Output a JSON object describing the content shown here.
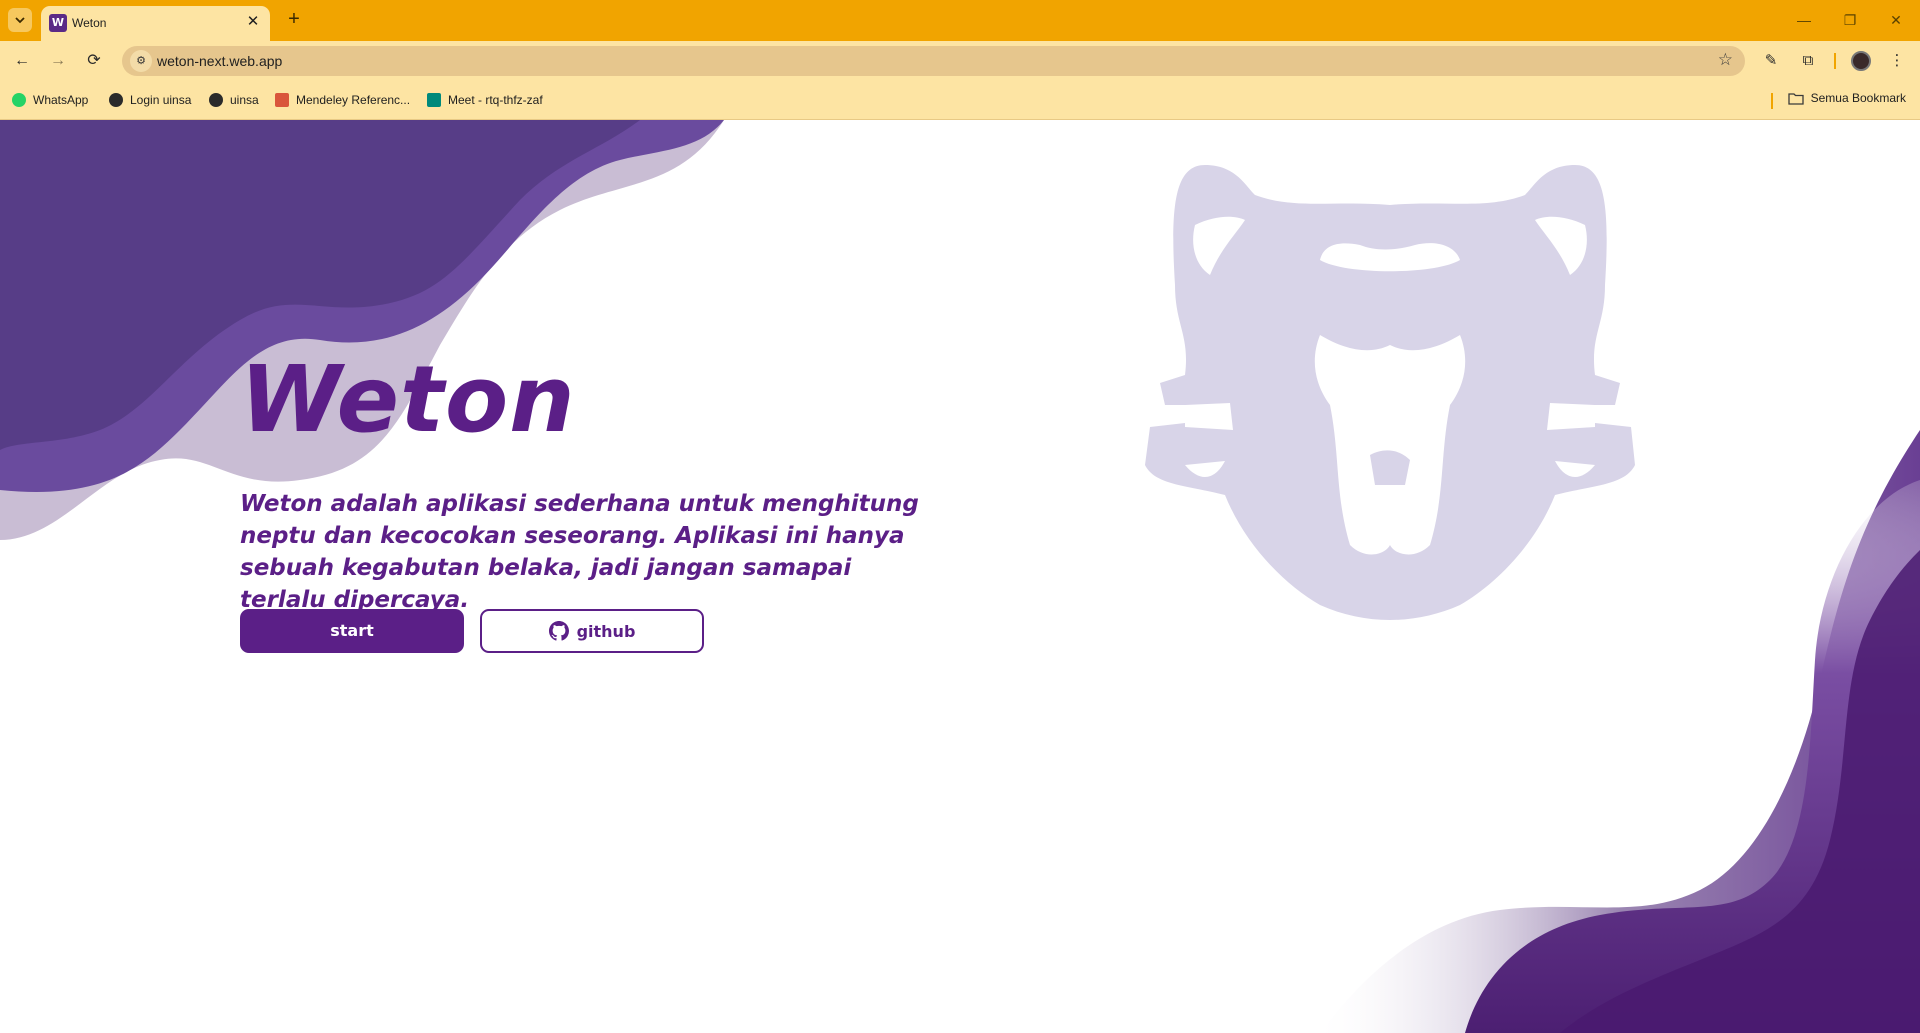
{
  "browser": {
    "tab_title": "Weton",
    "favicon_letter": "W",
    "url": "weton-next.web.app",
    "bookmarks": [
      {
        "label": "WhatsApp",
        "icon": "whatsapp-icon",
        "color": "#25d366"
      },
      {
        "label": "Login uinsa",
        "icon": "globe-icon",
        "color": "#2b2b2b"
      },
      {
        "label": "uinsa",
        "icon": "globe-icon",
        "color": "#2b2b2b"
      },
      {
        "label": "Mendeley Referenc...",
        "icon": "mendeley-icon",
        "color": "#d9553b"
      },
      {
        "label": "Meet - rtq-thfz-zaf",
        "icon": "meet-icon",
        "color": "#00897b"
      }
    ],
    "all_bookmarks": "Semua Bookmark"
  },
  "hero": {
    "title": "Weton",
    "description": "Weton adalah aplikasi sederhana untuk menghitung neptu dan kecocokan seseorang. Aplikasi ini hanya sebuah kegabutan belaka, jadi jangan samapai terlalu dipercaya.",
    "start_label": "start",
    "github_label": "github"
  },
  "colors": {
    "brand": "#5b1f87",
    "tabbar": "#f1a400",
    "toolbar": "#fde4a3",
    "mascot": "#d8d4e8"
  }
}
